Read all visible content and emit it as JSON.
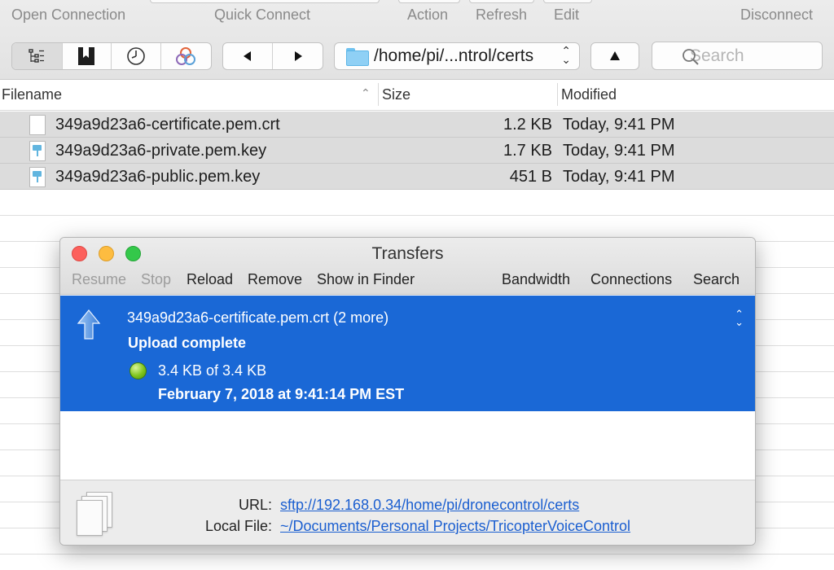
{
  "toolbar": {
    "open_connection": "Open Connection",
    "quick_connect": "Quick Connect",
    "action": "Action",
    "refresh": "Refresh",
    "edit": "Edit",
    "disconnect": "Disconnect",
    "path": "/home/pi/...ntrol/certs",
    "search_placeholder": "Search",
    "view_modes": [
      "browser-icon",
      "bookmarks-icon",
      "history-icon",
      "bonjour-icon"
    ],
    "nav": [
      "back-icon",
      "forward-icon"
    ]
  },
  "file_list": {
    "columns": {
      "filename": "Filename",
      "size": "Size",
      "modified": "Modified"
    },
    "files": [
      {
        "name": "349a9d23a6-certificate.pem.crt",
        "size": "1.2 KB",
        "modified": "Today, 9:41 PM",
        "icon": "certificate-file-icon"
      },
      {
        "name": "349a9d23a6-private.pem.key",
        "size": "1.7 KB",
        "modified": "Today, 9:41 PM",
        "icon": "keynote-file-icon"
      },
      {
        "name": "349a9d23a6-public.pem.key",
        "size": "451 B",
        "modified": "Today, 9:41 PM",
        "icon": "keynote-file-icon"
      }
    ]
  },
  "transfers": {
    "title": "Transfers",
    "actions": {
      "resume": "Resume",
      "stop": "Stop",
      "reload": "Reload",
      "remove": "Remove",
      "show_in_finder": "Show in Finder",
      "bandwidth": "Bandwidth",
      "connections": "Connections",
      "search": "Search"
    },
    "item": {
      "name": "349a9d23a6-certificate.pem.crt (2 more)",
      "status": "Upload complete",
      "progress": "3.4 KB of 3.4 KB",
      "date": "February 7, 2018 at 9:41:14 PM EST"
    },
    "footer": {
      "url_label": "URL:",
      "url": "sftp://192.168.0.34/home/pi/dronecontrol/certs",
      "local_label": "Local File:",
      "local": "~/Documents/Personal Projects/TricopterVoiceControl"
    }
  },
  "colors": {
    "selection": "#1a68d6",
    "link": "#1a5ed0",
    "status_dot": "#7fc41c"
  }
}
